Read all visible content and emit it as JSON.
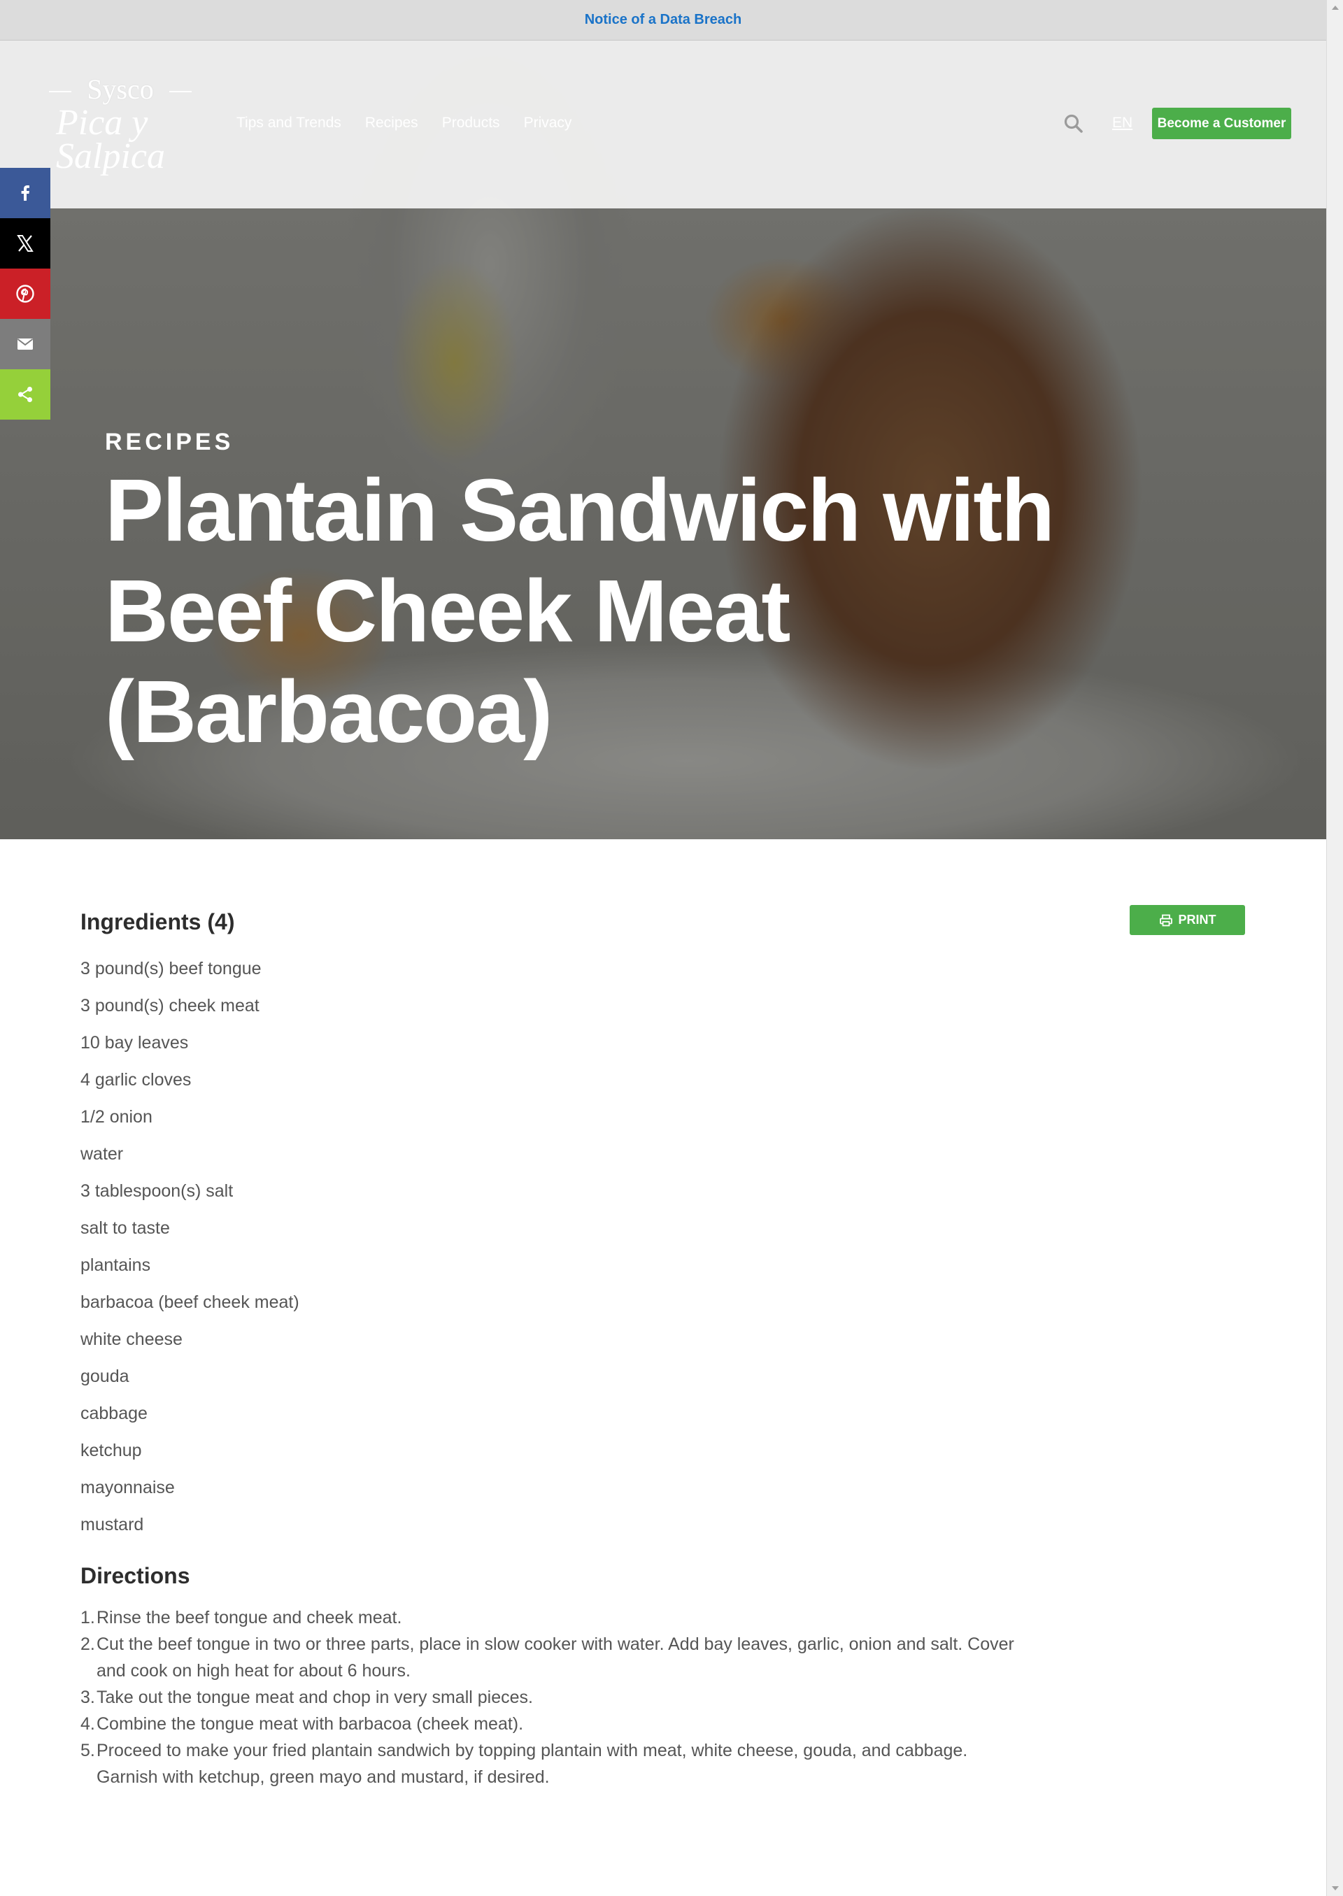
{
  "notice": {
    "label": "Notice of a Data Breach"
  },
  "brand": {
    "name_top": "Sysco",
    "name_script": "Pica y Salpica"
  },
  "nav": {
    "items": [
      "Tips and Trends",
      "Recipes",
      "Products",
      "Privacy"
    ],
    "language": "EN",
    "cta_label": "Become a Customer",
    "search_icon": "search-icon"
  },
  "share": {
    "items": [
      {
        "name": "facebook",
        "icon": "facebook-icon",
        "color": "#3b5998"
      },
      {
        "name": "x",
        "icon": "x-icon",
        "color": "#000000"
      },
      {
        "name": "pinterest",
        "icon": "pinterest-icon",
        "color": "#cb2027"
      },
      {
        "name": "email",
        "icon": "email-icon",
        "color": "#7d7d7d"
      },
      {
        "name": "share",
        "icon": "share-icon",
        "color": "#95d03a"
      }
    ]
  },
  "hero": {
    "kicker": "RECIPES",
    "title": "Plantain Sandwich with Beef Cheek Meat (Barbacoa)"
  },
  "recipe": {
    "ingredients_heading": "Ingredients (4)",
    "print_label": "PRINT",
    "ingredients": [
      "3 pound(s) beef tongue",
      "3 pound(s) cheek meat",
      "10 bay leaves",
      "4 garlic cloves",
      "1/2 onion",
      "water",
      "3 tablespoon(s) salt",
      "salt to taste",
      "plantains",
      "barbacoa (beef cheek meat)",
      "white cheese",
      "gouda",
      "cabbage",
      "ketchup",
      "mayonnaise",
      "mustard"
    ],
    "directions_heading": "Directions",
    "directions": [
      {
        "num": "1.",
        "text": "Rinse the beef tongue and cheek meat."
      },
      {
        "num": "2.",
        "text": "Cut the beef tongue in two or three parts, place in slow cooker with water. Add bay leaves, garlic, onion and salt. Cover and cook on high heat for about 6 hours."
      },
      {
        "num": "3.",
        "text": "Take out the tongue meat and chop in very small pieces."
      },
      {
        "num": "4.",
        "text": "Combine the tongue meat with barbacoa (cheek meat)."
      },
      {
        "num": "5.",
        "text": "Proceed to make your fried plantain sandwich by topping plantain with meat, white cheese, gouda, and cabbage. Garnish with ketchup, green mayo and mustard, if desired."
      }
    ]
  },
  "colors": {
    "accent_green": "#4cae4a",
    "notice_link": "#1a73c8"
  }
}
